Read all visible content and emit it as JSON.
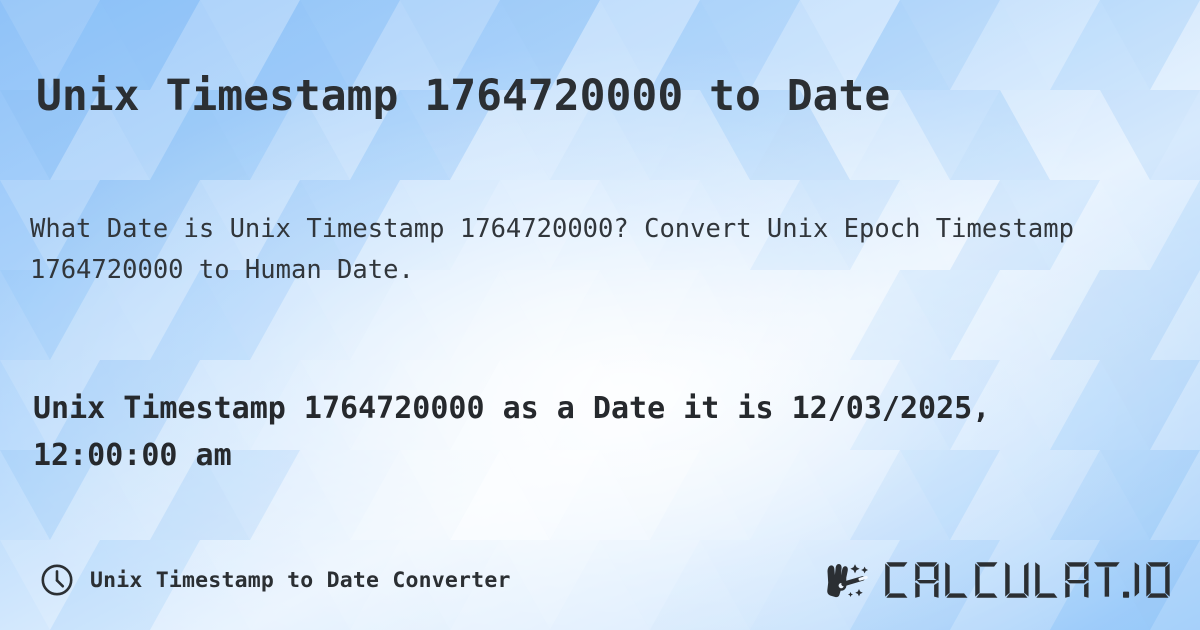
{
  "meta": {
    "timestamp": "1764720000",
    "converted_date": "12/03/2025, 12:00:00 am",
    "background_color_light": "#eaf4fe",
    "background_color_mid": "#bcdcfc",
    "background_color_deep": "#8fc2f8",
    "text_color": "#2b2f33"
  },
  "header": {
    "title": "Unix Timestamp 1764720000 to Date"
  },
  "main": {
    "description": "What Date is Unix Timestamp 1764720000? Convert Unix Epoch Timestamp 1764720000 to Human Date.",
    "result": "Unix Timestamp 1764720000 as a Date it is 12/03/2025, 12:00:00 am"
  },
  "footer": {
    "clock_icon": "clock-icon",
    "label": "Unix Timestamp to Date Converter",
    "brand": {
      "wand_icon": "magic-wand-hand-icon",
      "name": "CALCULAT.IO"
    }
  }
}
